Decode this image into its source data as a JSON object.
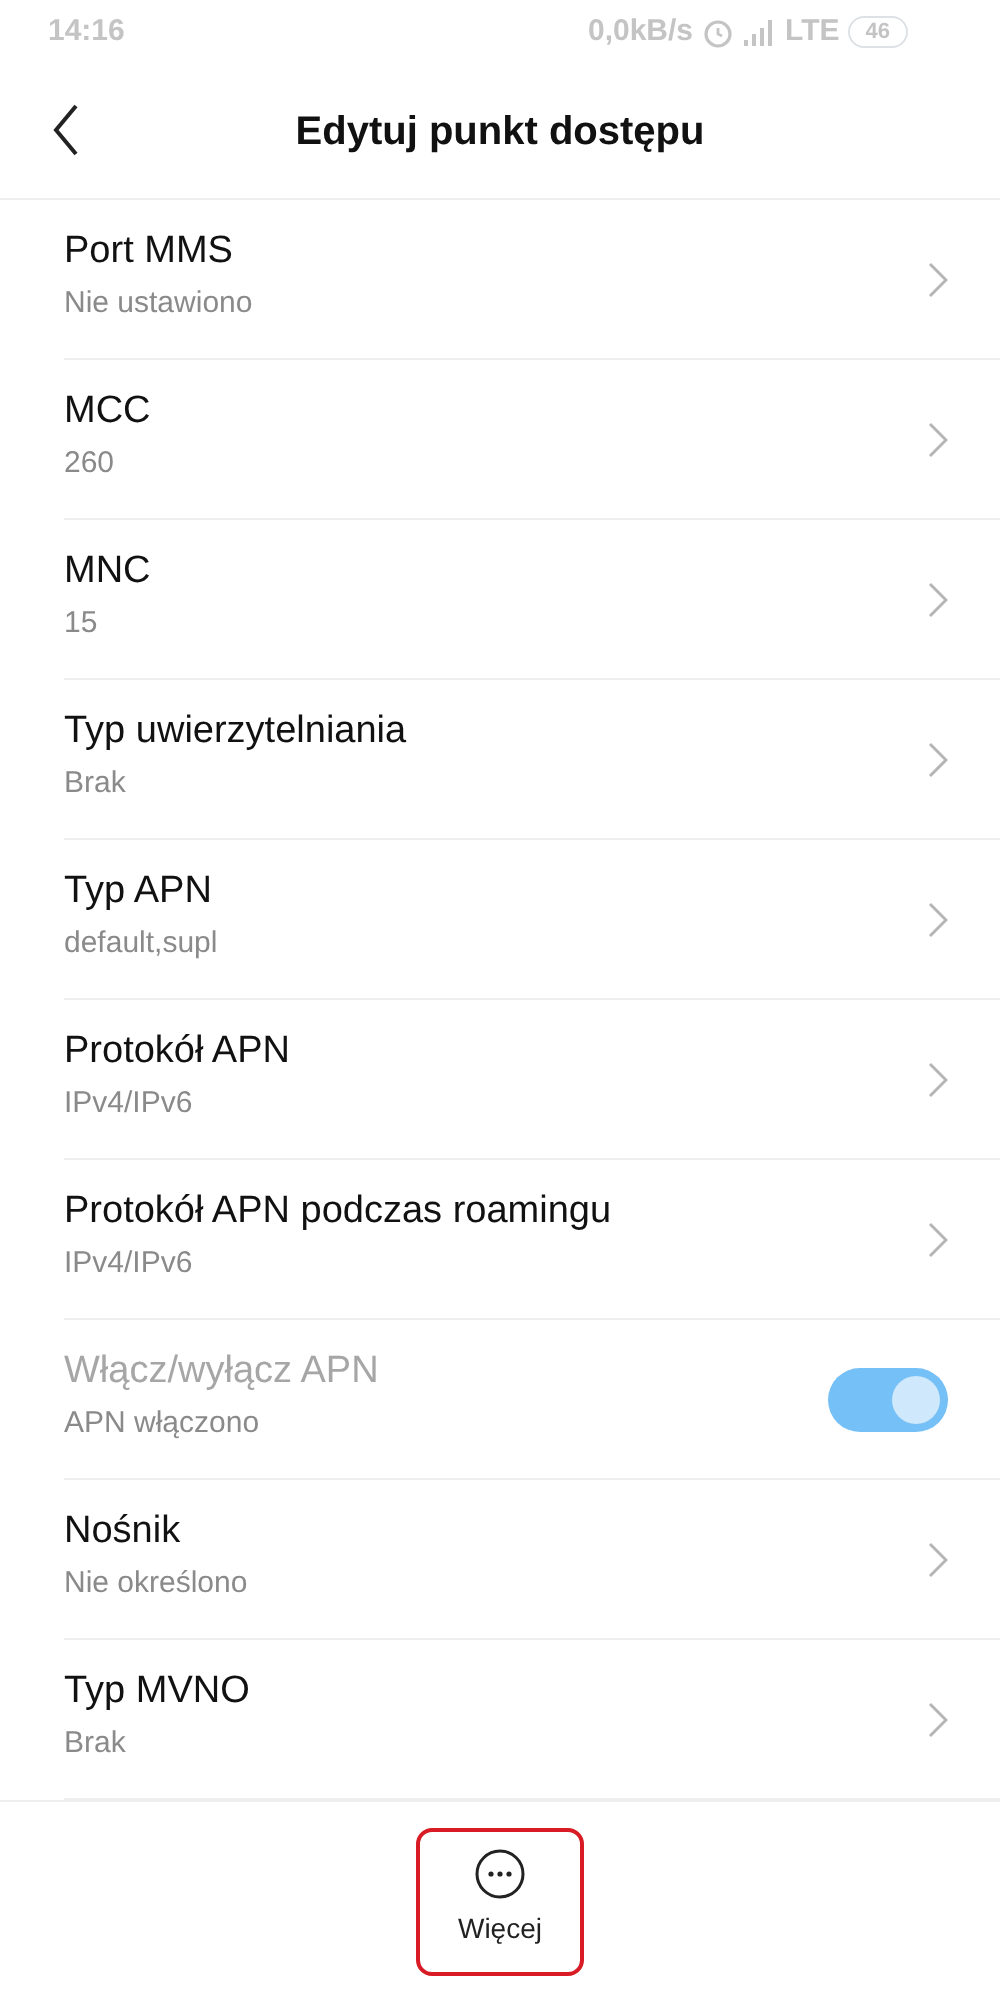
{
  "status_bar": {
    "time": "14:16",
    "speed": "0,0kB/s",
    "network": "LTE",
    "battery": "46"
  },
  "header": {
    "title": "Edytuj punkt dostępu"
  },
  "rows": [
    {
      "kind": "nav",
      "title": "Port MMS",
      "value": "Nie ustawiono",
      "disabled": false
    },
    {
      "kind": "nav",
      "title": "MCC",
      "value": "260",
      "disabled": false
    },
    {
      "kind": "nav",
      "title": "MNC",
      "value": "15",
      "disabled": false
    },
    {
      "kind": "nav",
      "title": "Typ uwierzytelniania",
      "value": "Brak",
      "disabled": false
    },
    {
      "kind": "nav",
      "title": "Typ APN",
      "value": "default,supl",
      "disabled": false
    },
    {
      "kind": "nav",
      "title": "Protokół APN",
      "value": "IPv4/IPv6",
      "disabled": false
    },
    {
      "kind": "nav",
      "title": "Protokół APN podczas roamingu",
      "value": "IPv4/IPv6",
      "disabled": false
    },
    {
      "kind": "toggle",
      "title": "Włącz/wyłącz APN",
      "value": "APN włączono",
      "disabled": true,
      "on": true
    },
    {
      "kind": "nav",
      "title": "Nośnik",
      "value": "Nie określono",
      "disabled": false
    },
    {
      "kind": "nav",
      "title": "Typ MVNO",
      "value": "Brak",
      "disabled": false
    }
  ],
  "bottom_bar": {
    "button": {
      "label": "Więcej",
      "highlighted": true
    }
  }
}
